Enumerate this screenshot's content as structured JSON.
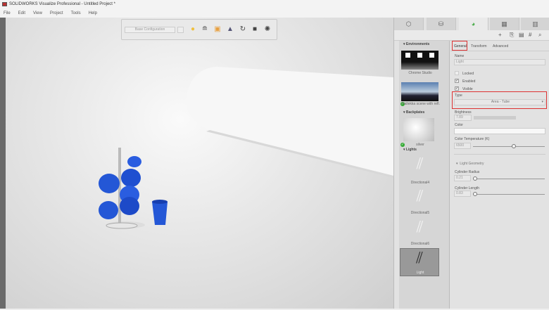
{
  "window": {
    "title": "SOLIDWORKS Visualize Professional - Untitled Project *"
  },
  "menu": [
    "File",
    "Edit",
    "View",
    "Project",
    "Tools",
    "Help"
  ],
  "viewport_toolbar": {
    "configuration": "Base Configuration",
    "icons": [
      "sun-icon",
      "render-icon",
      "camera-icon",
      "light-icon",
      "refresh-icon",
      "cube-icon",
      "aperture-icon"
    ]
  },
  "panel": {
    "tabs": [
      "models-icon",
      "appearances-icon",
      "scenes-icon",
      "cameras-icon",
      "libraries-icon"
    ],
    "tools": [
      "+",
      "add-file-icon",
      "save-icon",
      "grid-icon",
      "search-icon"
    ],
    "list": {
      "environments_header": "Environments",
      "environments": [
        {
          "label": "Chrome Studio",
          "active": false
        },
        {
          "label": "Hallekka scene with refl...",
          "active": true
        }
      ],
      "backplates_header": "Backplates",
      "backplates": [
        {
          "label": "silver",
          "active": true
        }
      ],
      "lights_header": "Lights",
      "lights": [
        {
          "label": "Directional4"
        },
        {
          "label": "Directional5"
        },
        {
          "label": "Directional6"
        },
        {
          "label": "Light"
        }
      ]
    },
    "props": {
      "tabs": [
        "General",
        "Transform",
        "Advanced"
      ],
      "name_label": "Name",
      "name_value": "Light",
      "locked": "Locked",
      "enabled": "Enabled",
      "visible": "Visible",
      "type_label": "Type",
      "type_value": "Area - Tube",
      "brightness_label": "Brightness",
      "brightness_value": "7.89",
      "color_label": "Color",
      "temp_label": "Color Temperature (K)",
      "temp_value": "6500",
      "temp_fraction": 0.55,
      "geometry_header": "Light Geometry",
      "radius_label": "Cylinder Radius",
      "radius_value": "0.21",
      "radius_fraction": 0.0,
      "length_label": "Cylinder Length",
      "length_value": "0.83",
      "length_fraction": 0.0
    }
  }
}
